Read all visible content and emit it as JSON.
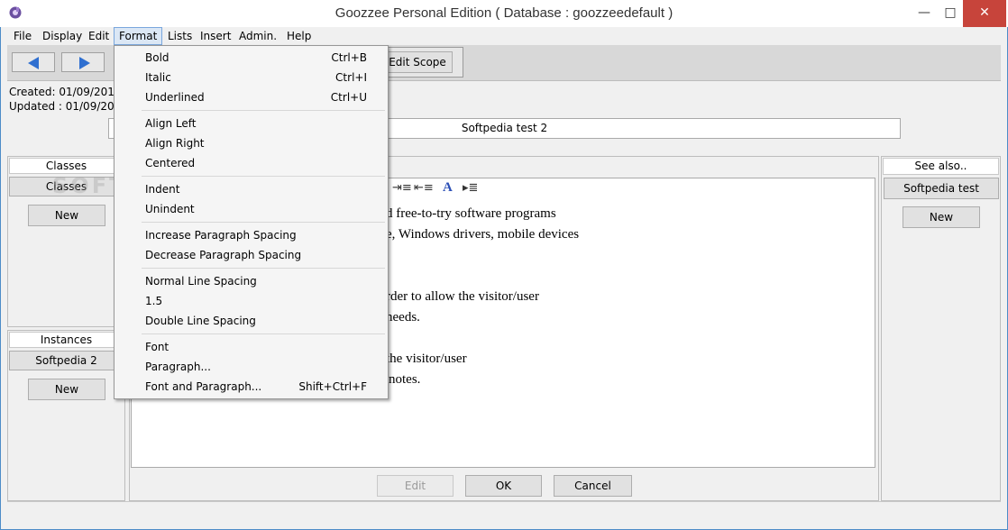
{
  "window": {
    "title": "Goozzee Personal Edition ( Database : goozzeedefault )",
    "minimize_glyph": "—",
    "maximize_glyph": "□",
    "close_glyph": "✕"
  },
  "menubar": {
    "items": [
      "File",
      "Display",
      "Edit",
      "Format",
      "Lists",
      "Insert",
      "Admin.",
      "Help"
    ],
    "active": "Format"
  },
  "toolbar": {
    "back_icon": "left-arrow-icon",
    "forward_icon": "right-arrow-icon",
    "edit_scope_label": "Edit Scope"
  },
  "info": {
    "created": "Created:   01/09/2015 (",
    "updated": "Updated : 01/09/2015 (",
    "record_name": "Softpedia test 2"
  },
  "classes_panel": {
    "header": "Classes",
    "item": "Classes",
    "new_label": "New"
  },
  "instances_panel": {
    "header": "Instances",
    "item": "Softpedia 2",
    "new_label": "New"
  },
  "see_also_panel": {
    "header": "See also..",
    "item": "Softpedia test",
    "new_label": "New"
  },
  "editor": {
    "lines": [
      "d free-to-try software programs",
      "e, Windows drivers, mobile devices",
      "",
      "rder to allow the visitor/user",
      " needs.",
      "",
      "the visitor/user",
      "notes."
    ]
  },
  "bottom_buttons": {
    "edit": "Edit",
    "ok": "OK",
    "cancel": "Cancel"
  },
  "format_menu": {
    "groups": [
      [
        {
          "label": "Bold",
          "shortcut": "Ctrl+B"
        },
        {
          "label": "Italic",
          "shortcut": "Ctrl+I"
        },
        {
          "label": "Underlined",
          "shortcut": "Ctrl+U"
        }
      ],
      [
        {
          "label": "Align Left",
          "shortcut": ""
        },
        {
          "label": "Align Right",
          "shortcut": ""
        },
        {
          "label": "Centered",
          "shortcut": ""
        }
      ],
      [
        {
          "label": "Indent",
          "shortcut": ""
        },
        {
          "label": "Unindent",
          "shortcut": ""
        }
      ],
      [
        {
          "label": "Increase Paragraph Spacing",
          "shortcut": ""
        },
        {
          "label": "Decrease Paragraph Spacing",
          "shortcut": ""
        }
      ],
      [
        {
          "label": "Normal Line Spacing",
          "shortcut": ""
        },
        {
          "label": "1.5",
          "shortcut": ""
        },
        {
          "label": "Double Line Spacing",
          "shortcut": ""
        }
      ],
      [
        {
          "label": "Font",
          "shortcut": ""
        },
        {
          "label": "Paragraph...",
          "shortcut": ""
        },
        {
          "label": "Font and Paragraph...",
          "shortcut": "Shift+Ctrl+F"
        }
      ]
    ]
  },
  "watermark": "SOFTPEDIA",
  "colors": {
    "accent": "#3a78d8",
    "close_button": "#c7443b",
    "menu_highlight": "#dbe7f5"
  }
}
